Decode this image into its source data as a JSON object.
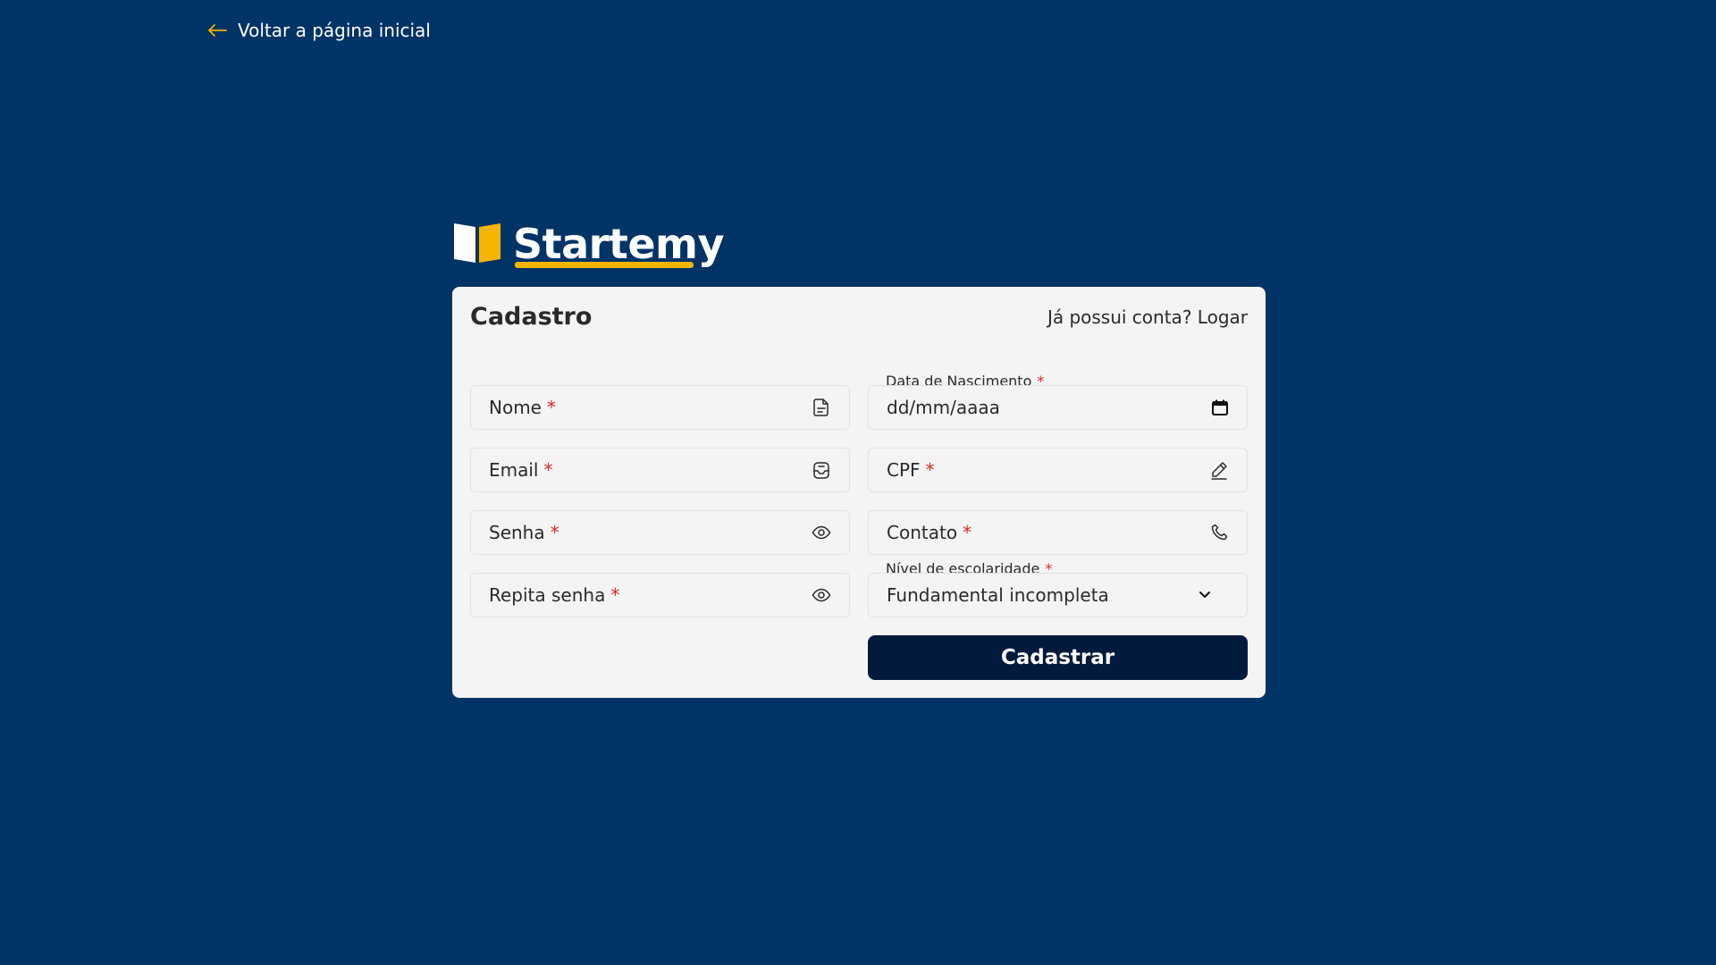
{
  "nav": {
    "back_label": "Voltar a página inicial"
  },
  "brand": {
    "name": "Startemy",
    "accent": "#f5b400",
    "background": "#003366"
  },
  "card": {
    "title": "Cadastro",
    "login_prompt": "Já possui conta? Logar"
  },
  "fields": {
    "nome": {
      "label": "Nome",
      "required": "*",
      "icon": "document-icon"
    },
    "email": {
      "label": "Email",
      "required": "*",
      "icon": "mailbox-icon"
    },
    "senha": {
      "label": "Senha",
      "required": "*",
      "icon": "eye-icon"
    },
    "repita_senha": {
      "label": "Repita senha",
      "required": "*",
      "icon": "eye-icon"
    },
    "nascimento": {
      "label": "Data de Nascimento",
      "required": "*",
      "placeholder": "dd/mm/aaaa",
      "icon": "calendar-icon"
    },
    "cpf": {
      "label": "CPF",
      "required": "*",
      "icon": "pencil-icon"
    },
    "contato": {
      "label": "Contato",
      "required": "*",
      "icon": "phone-icon"
    },
    "escolaridade": {
      "label": "Nível de escolaridade",
      "required": "*",
      "value": "Fundamental incompleta",
      "icon": "chevron-down-icon"
    }
  },
  "actions": {
    "submit_label": "Cadastrar",
    "submit_color": "#021b3d"
  }
}
